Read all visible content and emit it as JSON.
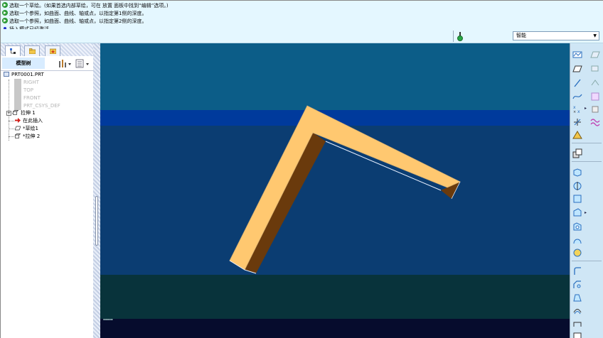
{
  "messages": [
    {
      "icon": "status-ok-icon",
      "text": "选取一个草绘。(如果首选内部草绘，可在 放置 面板中找到“编辑”选项。)"
    },
    {
      "icon": "status-ok-icon",
      "text": "选取一个参照，如曲面、曲线、轴或点，以指定第1侧的深度。"
    },
    {
      "icon": "status-ok-icon",
      "text": "选取一个参照，如曲面、曲线、轴或点，以指定第2侧的深度。"
    },
    {
      "icon": "info-dot-icon",
      "text": "插入模式已经激活。"
    }
  ],
  "filter": {
    "value": "智能"
  },
  "model_tree": {
    "title": "模型树",
    "items": [
      {
        "label": "PRT0001.PRT",
        "state": "normal"
      },
      {
        "label": "RIGHT",
        "state": "dim"
      },
      {
        "label": "TOP",
        "state": "dim"
      },
      {
        "label": "FRONT",
        "state": "dim"
      },
      {
        "label": "PRT_CSYS_DEF",
        "state": "dim"
      },
      {
        "label": "拉伸 1",
        "state": "normal"
      },
      {
        "label": "在此插入",
        "state": "normal"
      },
      {
        "label": "*草绘1",
        "state": "normal"
      },
      {
        "label": "*拉伸 2",
        "state": "normal"
      }
    ]
  },
  "colors": {
    "viewport_bg": "#0d5b86",
    "part_face": "#ffc870",
    "part_side": "#6a3a0c",
    "message_bg": "#e4f7ff"
  },
  "icons": {
    "tabs": [
      "model-tree-tab-icon",
      "folder-browser-tab-icon",
      "favorites-tab-icon"
    ],
    "tree_toolbar": [
      "settings-icon",
      "show-icon"
    ],
    "right_toolbar": [
      "datum-plane-icon",
      "datum-axis-icon",
      "curve-icon",
      "datum-point-icon",
      "csys-icon",
      "analysis-icon",
      "extrude-icon",
      "revolve-icon",
      "hole-icon",
      "round-icon",
      "chamfer-icon",
      "shell-icon",
      "rib-icon",
      "draft-icon",
      "pattern-icon",
      "mirror-icon",
      "merge-icon",
      "trim-icon",
      "offset-icon",
      "thicken-icon",
      "solidify-icon"
    ]
  }
}
